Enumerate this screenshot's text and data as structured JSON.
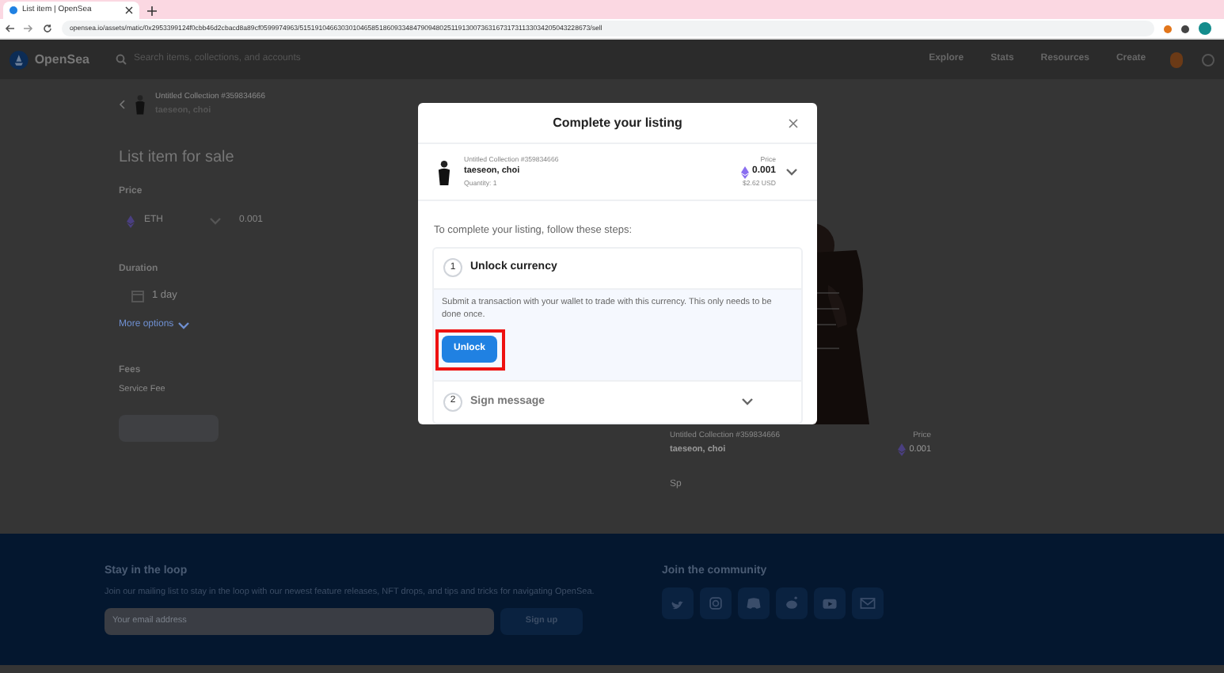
{
  "browser": {
    "tab_title": "List item | OpenSea",
    "url": "opensea.io/assets/matic/0x2953399124f0cbb46d2cbacd8a89cf0599974963/51519104663030104658518609334847909480251191300736316731731133034205043228673/sell"
  },
  "header": {
    "logo": "OpenSea",
    "search_placeholder": "Search items, collections, and accounts",
    "nav": [
      "Explore",
      "Stats",
      "Resources",
      "Create"
    ]
  },
  "listing": {
    "collection": "Untitled Collection #359834666",
    "item_name": "taeseon, choi",
    "title": "List item for sale",
    "price_label": "Price",
    "currency": "ETH",
    "price": "0.001",
    "duration_label": "Duration",
    "duration": "1 day",
    "more_options": "More options",
    "fees_label": "Fees",
    "service_fee": "Service Fee"
  },
  "preview": {
    "collection": "Untitled Collection #359834666",
    "item_name": "taeseon, choi",
    "price_label": "Price",
    "price": "0.001",
    "note": "Sp"
  },
  "modal": {
    "title": "Complete your listing",
    "item": {
      "collection": "Untitled Collection #359834666",
      "name": "taeseon, choi",
      "quantity": "Quantity: 1",
      "price_label": "Price",
      "price": "0.001",
      "usd": "$2.62 USD"
    },
    "intro": "To complete your listing, follow these steps:",
    "steps": [
      {
        "number": "1",
        "title": "Unlock currency",
        "expanded": true,
        "description": "Submit a transaction with your wallet to trade with this currency. This only needs to be done once.",
        "button": "Unlock"
      },
      {
        "number": "2",
        "title": "Sign message",
        "expanded": false
      }
    ]
  },
  "footer": {
    "newsletter_title": "Stay in the loop",
    "newsletter_text": "Join our mailing list to stay in the loop with our newest feature releases, NFT drops, and tips and tricks for navigating OpenSea.",
    "email_placeholder": "Your email address",
    "signup": "Sign up",
    "community_title": "Join the community",
    "social": [
      {
        "kind": "twitter"
      },
      {
        "kind": "instagram"
      },
      {
        "kind": "discord"
      },
      {
        "kind": "reddit"
      },
      {
        "kind": "youtube"
      },
      {
        "kind": "email"
      }
    ]
  }
}
